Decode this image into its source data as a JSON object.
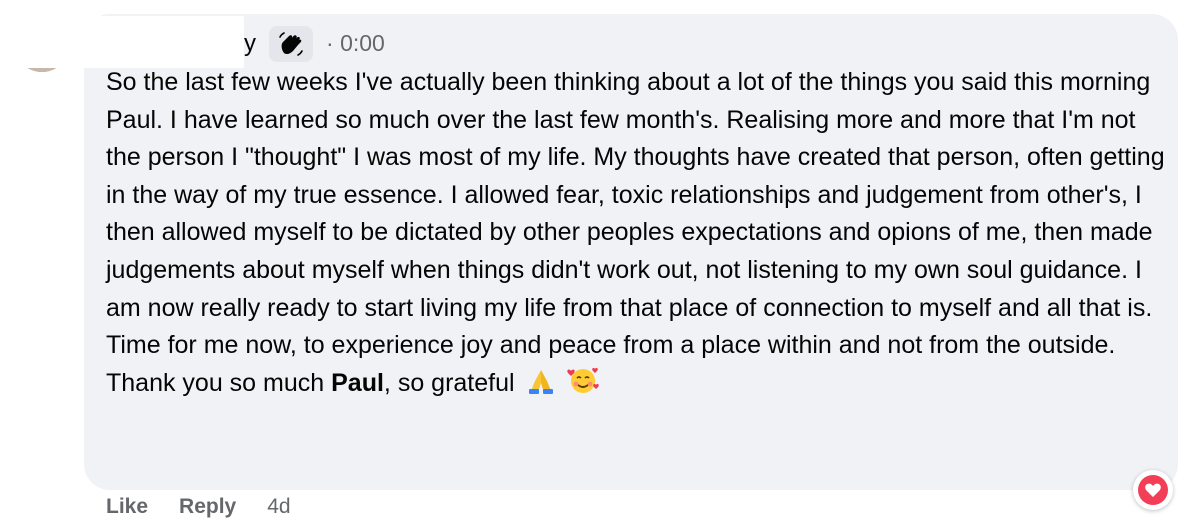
{
  "comment": {
    "author_suffix": "y",
    "badge_icon": "waving-hand-icon",
    "separator": "·",
    "timestamp": "0:00",
    "paragraph_main": "So the last few weeks I've actually been thinking about a lot of the things you said this morning Paul. I have learned so much over the last few month's. Realising more and more that I'm not the person I \"thought\" I was most of my life. My thoughts have created that person, often getting in the way of my true essence. I allowed fear, toxic relationships and judgement from other's, I then allowed myself to be dictated by other peoples expectations and opions of me, then made judgements about myself when things didn't work out, not listening to my own soul guidance. I am now really ready to start living my life from that place of connection to myself and all that is. Time for me now, to experience joy and peace from a place within and not from the outside.",
    "thanks_prefix": "Thank you so much ",
    "mention": "Paul",
    "thanks_suffix": ", so grateful",
    "emojis": [
      "folded-hands-icon",
      "smiling-face-with-hearts-icon"
    ]
  },
  "actions": {
    "like_label": "Like",
    "reply_label": "Reply",
    "age": "4d"
  },
  "reaction": {
    "icon": "heart-icon",
    "color": "#f33e58"
  }
}
